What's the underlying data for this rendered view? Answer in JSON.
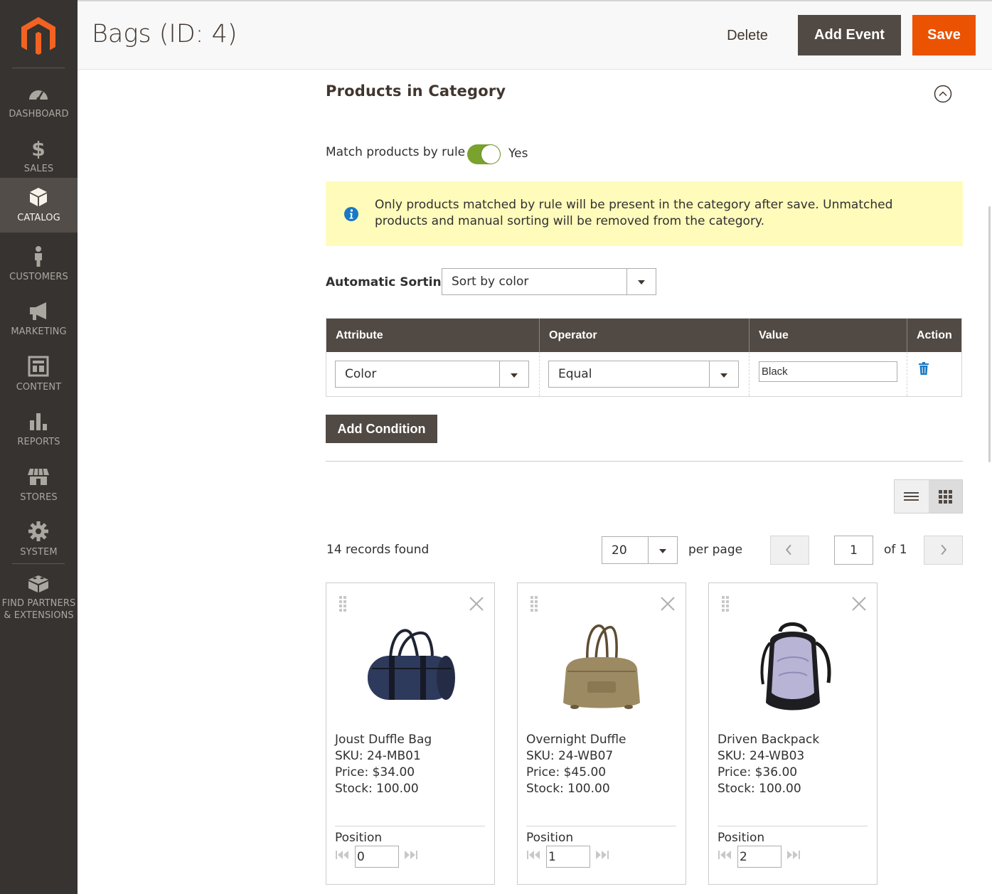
{
  "sidebar": {
    "logo_icon": "magento-logo-icon",
    "items": [
      {
        "label": "DASHBOARD",
        "icon": "speedometer-icon"
      },
      {
        "label": "SALES",
        "icon": "dollar-icon"
      },
      {
        "label": "CATALOG",
        "icon": "box-icon",
        "active": true
      },
      {
        "label": "CUSTOMERS",
        "icon": "person-icon"
      },
      {
        "label": "MARKETING",
        "icon": "megaphone-icon"
      },
      {
        "label": "CONTENT",
        "icon": "layout-icon"
      },
      {
        "label": "REPORTS",
        "icon": "bar-chart-icon"
      },
      {
        "label": "STORES",
        "icon": "storefront-icon"
      },
      {
        "label": "SYSTEM",
        "icon": "gear-icon"
      },
      {
        "label_line1": "FIND PARTNERS",
        "label_line2": "& EXTENSIONS",
        "icon": "blocks-icon"
      }
    ]
  },
  "header": {
    "title": "Bags (ID: 4)",
    "delete_label": "Delete",
    "add_event_label": "Add Event",
    "save_label": "Save"
  },
  "section": {
    "title": "Products in Category",
    "collapse_icon": "chevron-up-circle-icon",
    "match_label": "Match products by rule",
    "match_enabled": true,
    "match_value": "Yes",
    "notice": "Only products matched by rule will be present in the category after save. Unmatched products and manual sorting will be removed from the category.",
    "sort_label": "Automatic Sorting",
    "sort_value": "Sort by color"
  },
  "conditions": {
    "headers": {
      "attribute": "Attribute",
      "operator": "Operator",
      "value": "Value",
      "action": "Action"
    },
    "rows": [
      {
        "attribute": "Color",
        "operator": "Equal",
        "value": "Black",
        "action_icon": "trash-icon"
      }
    ],
    "add_label": "Add Condition"
  },
  "grid": {
    "view_modes": [
      "list-view-icon",
      "grid-view-icon"
    ],
    "active_view": "grid",
    "records_found": "14 records found",
    "per_page": "20",
    "per_page_label": "per page",
    "current_page": "1",
    "of_label": "of 1"
  },
  "products": [
    {
      "name": "Joust Duffle Bag",
      "sku": "SKU: 24-MB01",
      "price": "Price: $34.00",
      "stock": "Stock: 100.00",
      "position_label": "Position",
      "position": "0"
    },
    {
      "name": "Overnight Duffle",
      "sku": "SKU: 24-WB07",
      "price": "Price: $45.00",
      "stock": "Stock: 100.00",
      "position_label": "Position",
      "position": "1"
    },
    {
      "name": "Driven Backpack",
      "sku": "SKU: 24-WB03",
      "price": "Price: $36.00",
      "stock": "Stock: 100.00",
      "position_label": "Position",
      "position": "2"
    }
  ],
  "colors": {
    "sidebar_bg": "#373330",
    "sidebar_active": "#524d49",
    "accent_orange": "#eb5202",
    "dark_button": "#514943",
    "toggle_on": "#79a22e",
    "notice_bg": "#fffbbb",
    "info_blue": "#1979c3"
  }
}
